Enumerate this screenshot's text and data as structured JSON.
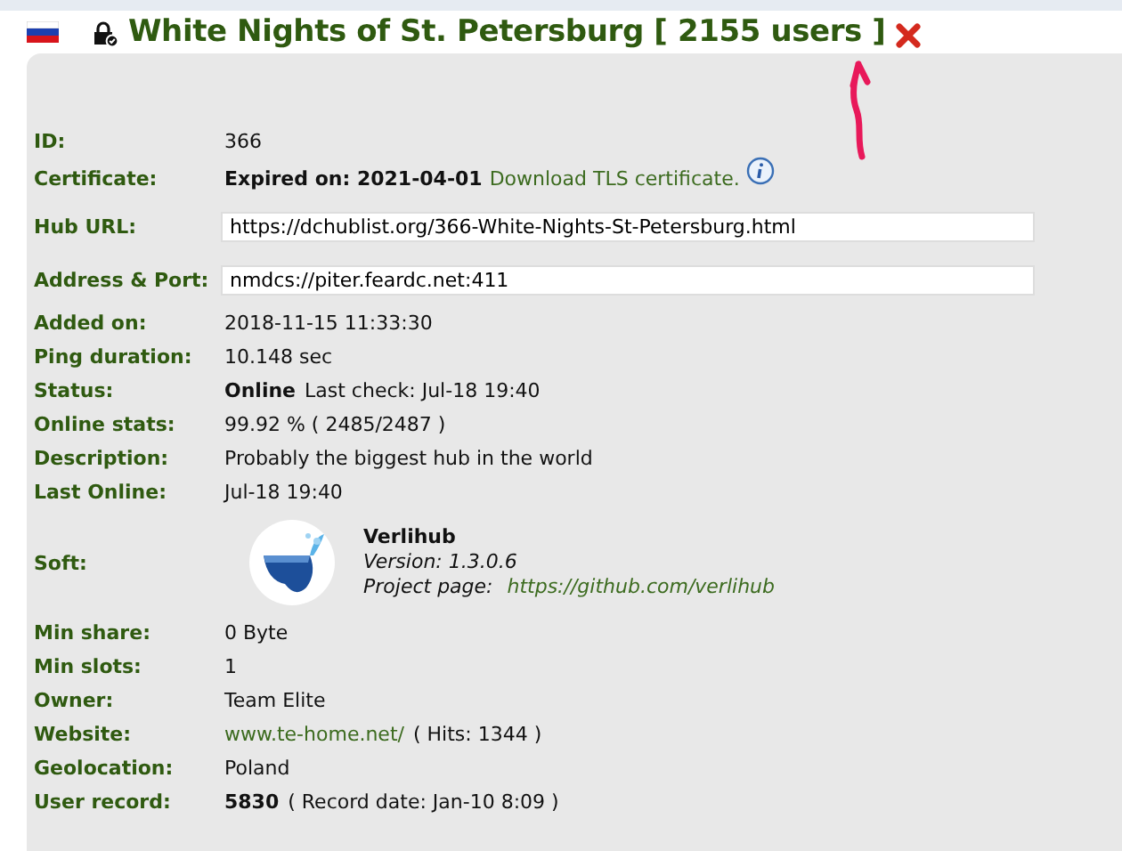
{
  "hub": {
    "title": "White Nights of St. Petersburg [ 2155 users ]"
  },
  "rows": [
    {
      "label": "ID:",
      "kind": "text",
      "parts": [
        {
          "kind": "plain",
          "text": "366"
        }
      ]
    },
    {
      "label": "Certificate:",
      "kind": "cert",
      "parts": [
        {
          "kind": "bold",
          "text": "Expired on: 2021-04-01"
        },
        {
          "kind": "link",
          "text": "Download TLS certificate."
        }
      ]
    },
    {
      "label": "Hub URL:",
      "kind": "field",
      "value": "https://dchublist.org/366-White-Nights-St-Petersburg.html"
    },
    {
      "label": "Address & Port:",
      "kind": "field",
      "value": "nmdcs://piter.feardc.net:411"
    },
    {
      "label": "Added on:",
      "kind": "text",
      "parts": [
        {
          "kind": "plain",
          "text": "2018-11-15 11:33:30"
        }
      ]
    },
    {
      "label": "Ping duration:",
      "kind": "text",
      "parts": [
        {
          "kind": "plain",
          "text": "10.148 sec"
        }
      ]
    },
    {
      "label": "Status:",
      "kind": "text",
      "parts": [
        {
          "kind": "bold",
          "text": "Online"
        },
        {
          "kind": "plain",
          "text": "Last check: Jul-18 19:40"
        }
      ]
    },
    {
      "label": "Online stats:",
      "kind": "text",
      "parts": [
        {
          "kind": "plain",
          "text": "99.92 % ( 2485/2487 )"
        }
      ]
    },
    {
      "label": "Description:",
      "kind": "text",
      "parts": [
        {
          "kind": "plain",
          "text": "Probably the biggest hub in the world"
        }
      ]
    },
    {
      "label": "Last Online:",
      "kind": "text",
      "parts": [
        {
          "kind": "plain",
          "text": "Jul-18 19:40"
        }
      ]
    },
    {
      "label": "Soft:",
      "kind": "soft",
      "name": "Verlihub",
      "version": "Version: 1.3.0.6",
      "project_label": "Project page:",
      "project_link": "https://github.com/verlihub"
    },
    {
      "label": "Min share:",
      "kind": "text",
      "parts": [
        {
          "kind": "plain",
          "text": "0 Byte"
        }
      ]
    },
    {
      "label": "Min slots:",
      "kind": "text",
      "parts": [
        {
          "kind": "plain",
          "text": "1"
        }
      ]
    },
    {
      "label": "Owner:",
      "kind": "text",
      "parts": [
        {
          "kind": "plain",
          "text": "Team Elite"
        }
      ]
    },
    {
      "label": "Website:",
      "kind": "text",
      "parts": [
        {
          "kind": "link",
          "text": "www.te-home.net/"
        },
        {
          "kind": "plain",
          "text": "( Hits: 1344 )"
        }
      ]
    },
    {
      "label": "Geolocation:",
      "kind": "text",
      "parts": [
        {
          "kind": "plain",
          "text": "Poland"
        }
      ]
    },
    {
      "label": "User record:",
      "kind": "text",
      "parts": [
        {
          "kind": "bold",
          "text": "5830"
        },
        {
          "kind": "plain",
          "text": "( Record date: Jan-10 8:09 )"
        }
      ]
    }
  ]
}
